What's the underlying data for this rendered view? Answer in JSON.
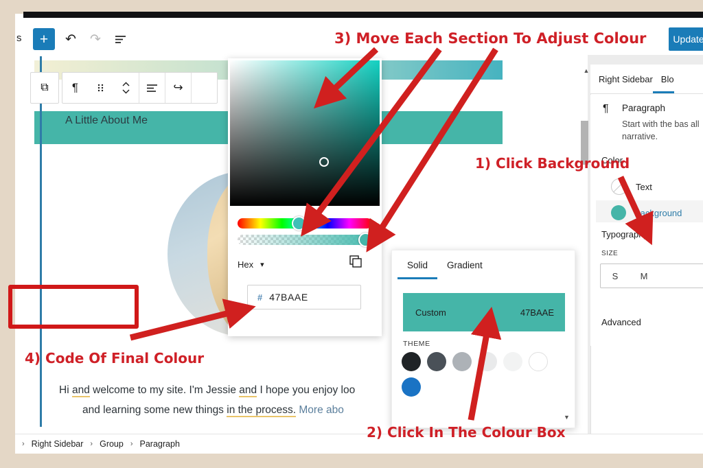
{
  "window": {
    "title_truncated_left": "s"
  },
  "toolbar": {
    "add_block_label": "+",
    "undo_icon": "undo-arrow",
    "redo_icon": "redo-arrow",
    "list_view_icon": "list-view",
    "update_label": "Update"
  },
  "block_toolbar": {
    "buttons": [
      {
        "name": "group-block-icon",
        "glyph": "⧉"
      },
      {
        "name": "paragraph-type-icon",
        "glyph": "¶"
      },
      {
        "name": "drag-handle-icon",
        "glyph": "⁙"
      },
      {
        "name": "move-updown-icon",
        "glyph": "⌃"
      },
      {
        "name": "align-icon",
        "glyph": "≡"
      },
      {
        "name": "link-icon",
        "glyph": "↪"
      }
    ]
  },
  "canvas": {
    "heading_text": "A Little About Me",
    "paragraph_line1_a": "Hi ",
    "paragraph_line1_u1": "and",
    "paragraph_line1_b": " welcome to my site. I'm Jessie ",
    "paragraph_line1_u2": "and",
    "paragraph_line1_c": " I hope you enjoy loo",
    "paragraph_line2_a": "and learning some new things ",
    "paragraph_line2_u1": "in the process.",
    "paragraph_line2_link": " More abo",
    "avatar_name": "profile-photo"
  },
  "sidebar": {
    "tabs": [
      {
        "label": "Right Sidebar",
        "active": false
      },
      {
        "label": "Blo",
        "active": true
      }
    ],
    "block": {
      "icon": "paragraph-icon",
      "title": "Paragraph",
      "description": "Start with the bas all narrative."
    },
    "color": {
      "section_label": "Color",
      "rows": [
        {
          "label": "Text",
          "swatch": "none",
          "selected": false
        },
        {
          "label": "Background",
          "swatch": "#45b5a8",
          "selected": true
        }
      ]
    },
    "typography": {
      "section_label": "Typography",
      "size_caption": "SIZE",
      "sizes": [
        "S",
        "M"
      ]
    },
    "advanced_label": "Advanced"
  },
  "color_picker": {
    "saturation_base": "#13d1c2",
    "format_label": "Hex",
    "chevron_icon": "chevron-down-icon",
    "copy_icon": "copy-icon",
    "hash_symbol": "#",
    "hex_value": "47BAAE"
  },
  "solid_popover": {
    "tabs": [
      {
        "label": "Solid",
        "active": true
      },
      {
        "label": "Gradient",
        "active": false
      }
    ],
    "custom_label": "Custom",
    "custom_hex": "47BAAE",
    "theme_caption": "THEME",
    "theme_swatches": [
      "#1f2326",
      "#4a5158",
      "#adb2b7",
      "#e9eaeb",
      "#f2f3f3",
      "#ffffff",
      "#1a73c4"
    ]
  },
  "breadcrumb": {
    "items": [
      "Right Sidebar",
      "Group",
      "Paragraph"
    ],
    "separator": "›"
  },
  "annotations": {
    "step3": "3) Move Each Section To Adjust Colour",
    "step1": "1) Click Background",
    "step4": "4) Code Of Final Colour",
    "step2": "2) Click In The Colour Box",
    "arrow_color": "#d0201f"
  }
}
